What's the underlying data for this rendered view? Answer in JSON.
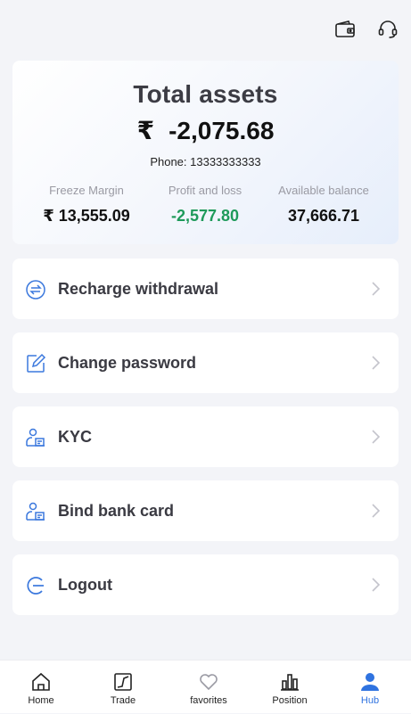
{
  "header": {
    "wallet_icon": "wallet-icon",
    "support_icon": "headset-icon"
  },
  "assets": {
    "title": "Total assets",
    "currency": "₹",
    "total": "-2,075.68",
    "phone": "Phone: 13333333333",
    "stats": [
      {
        "label": "Freeze Margin",
        "value": "₹ 13,555.09"
      },
      {
        "label": "Profit and loss",
        "value": "-2,577.80",
        "color": "#1e9a5a"
      },
      {
        "label": "Available balance",
        "value": "37,666.71"
      }
    ]
  },
  "menu": {
    "items": [
      {
        "label": "Recharge withdrawal",
        "icon": "exchange-icon"
      },
      {
        "label": "Change password",
        "icon": "edit-icon"
      },
      {
        "label": "KYC",
        "icon": "id-user-icon"
      },
      {
        "label": "Bind bank card",
        "icon": "id-user-icon"
      },
      {
        "label": "Logout",
        "icon": "logout-icon"
      }
    ]
  },
  "tabbar": {
    "active": "Hub",
    "accent": "#2f73e0",
    "tabs": [
      {
        "label": "Home",
        "icon": "home-icon"
      },
      {
        "label": "Trade",
        "icon": "trade-chart-icon"
      },
      {
        "label": "favorites",
        "icon": "heart-icon"
      },
      {
        "label": "Position",
        "icon": "bar-chart-icon"
      },
      {
        "label": "Hub",
        "icon": "user-icon"
      }
    ]
  }
}
